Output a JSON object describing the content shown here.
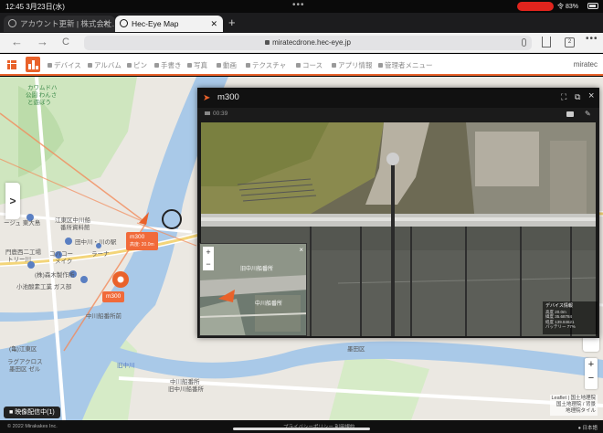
{
  "status_bar": {
    "time": "12:45  3月23日(水)",
    "recording": "",
    "system": "令 83%"
  },
  "tabs": [
    {
      "title": "アカウント更新 | 株式会社…",
      "active": false
    },
    {
      "title": "Hec-Eye Map",
      "active": true
    }
  ],
  "browser": {
    "url": "miratecdrone.hec-eye.jp",
    "new_tab": "+",
    "tab_count": "2",
    "back": "←",
    "forward": "→",
    "reload": "C"
  },
  "app_menu": {
    "items": [
      "デバイス",
      "アルバム",
      "ピン",
      "手書き",
      "写真",
      "動画",
      "テクスチャ",
      "コース",
      "アプリ情報",
      "管理者メニュー"
    ],
    "user": "miratec"
  },
  "map": {
    "labels": [
      "カワムドハ",
      "公園 わんさ",
      "と遊ぼう",
      "ージュ 東大島",
      "江東区中川船",
      "番所資料館",
      "田中川・川の駅",
      "ラーナ",
      "メイク",
      "門鹿西二工場",
      "トリー川",
      "コバコー",
      "(株)森木製作所",
      "小池酸素工業 ガス部",
      "中川船番所前",
      "(亀)江東区",
      "旧中川",
      "中川船番所",
      "旧中川船番所",
      "墨田区",
      "ラグアクロス",
      "墨田区 ゼル"
    ],
    "drone_tags": [
      {
        "name": "m300",
        "sub": "高度: 20.0m"
      },
      {
        "name": "m300",
        "sub": ""
      }
    ],
    "sidebar_toggle": ">",
    "zoom_in": "+",
    "zoom_out": "−",
    "attribution": [
      "Leaflet | 国土地理院",
      "国土地理院 / 背景",
      "地理院タイル"
    ],
    "live_badge": "映像配信中(1)"
  },
  "video": {
    "title": "m300",
    "subtitle": "00:39",
    "controls": {
      "expand": "⛶",
      "popout": "⧉",
      "close": "×"
    },
    "minimap": {
      "label": "旧中川船番所",
      "label2": "中川船番所",
      "zoom_in": "+",
      "zoom_out": "−",
      "close": "×"
    },
    "telemetry": {
      "title": "デバイス情報",
      "lines": [
        "高度 20.0m",
        "緯度 35.68784",
        "経度 139.84621",
        "バッテリー 77%"
      ]
    }
  },
  "bottom": {
    "copyright": "© 2022 Mirakakes Inc.",
    "links": "プライバシーポリシー   利用規約",
    "language": "● 日本語"
  },
  "colors": {
    "accent": "#e9622b",
    "water": "#a8c7e6",
    "park": "#c9e4b8"
  }
}
